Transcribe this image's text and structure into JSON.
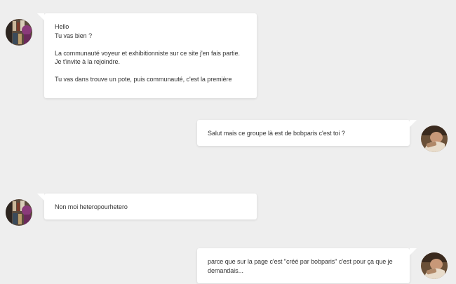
{
  "conversation": {
    "messages": [
      {
        "side": "left",
        "avatar_icon": "bookshelf-avatar-icon",
        "text": "Hello\nTu vas bien ?\n\nLa communauté voyeur et exhibitionniste sur ce site j'en fais partie. Je t'invite à la rejoindre.\n\nTu vas dans trouve un pote, puis communauté, c'est la première"
      },
      {
        "side": "right",
        "avatar_icon": "person-photo-avatar-icon",
        "text": "Salut mais ce groupe là est de bobparis c'est toi ?"
      },
      {
        "side": "left",
        "avatar_icon": "bookshelf-avatar-icon",
        "text": "Non moi heteropourhetero"
      },
      {
        "side": "right",
        "avatar_icon": "person-photo-avatar-icon",
        "text": "parce que sur la page c'est \"créé par bobparis\" c'est pour ça que je demandais..."
      }
    ]
  },
  "colors": {
    "background": "#eeeeee",
    "bubble": "#ffffff",
    "text": "#333333"
  }
}
